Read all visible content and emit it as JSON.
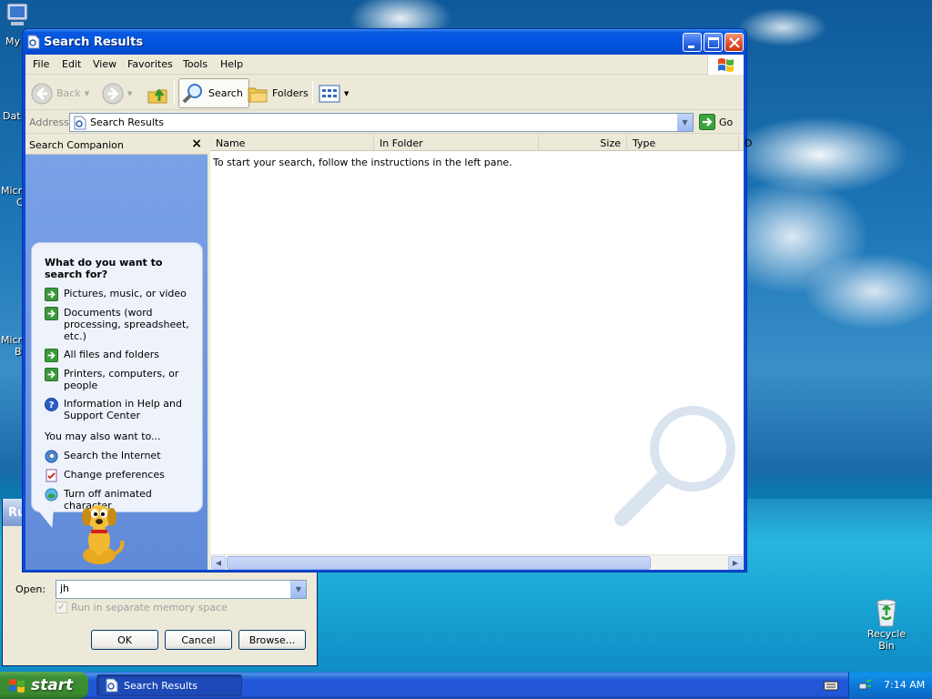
{
  "desktop": {
    "icons": [
      {
        "label": "My",
        "name": "my-computer"
      },
      {
        "label": "Dat",
        "name": "data"
      },
      {
        "label": "Micr",
        "name": "micr-1"
      },
      {
        "label": "C",
        "name": "c"
      },
      {
        "label": "Micr",
        "name": "micr-2"
      },
      {
        "label": "B",
        "name": "b"
      }
    ],
    "recycle_bin_label": "Recycle Bin"
  },
  "run_dialog": {
    "title_partial": "Ru",
    "open_label": "Open:",
    "open_value": "jh",
    "checkbox_label": "Run in separate memory space",
    "checkbox_checked": true,
    "ok_label": "OK",
    "cancel_label": "Cancel",
    "browse_label": "Browse..."
  },
  "window": {
    "title": "Search Results",
    "menu": [
      "File",
      "Edit",
      "View",
      "Favorites",
      "Tools",
      "Help"
    ],
    "toolbar": {
      "back_label": "Back",
      "search_label": "Search",
      "folders_label": "Folders"
    },
    "address": {
      "label": "Address",
      "value": "Search Results",
      "go_label": "Go"
    },
    "companion": {
      "header": "Search Companion",
      "question": "What do you want to search for?",
      "options": [
        "Pictures, music, or video",
        "Documents (word processing, spreadsheet, etc.)",
        "All files and folders",
        "Printers, computers, or people",
        "Information in Help and Support Center"
      ],
      "also_label": "You may also want to...",
      "also_options": [
        "Search the Internet",
        "Change preferences",
        "Turn off animated character"
      ]
    },
    "list": {
      "columns": [
        "Name",
        "In Folder",
        "Size",
        "Type",
        "D"
      ],
      "empty_message": "To start your search, follow the instructions in the left pane."
    }
  },
  "taskbar": {
    "start_label": "start",
    "task_label": "Search Results",
    "clock": "7:14 AM"
  },
  "colors": {
    "titlebar": "#0250d8",
    "taskbar": "#2157d7",
    "start_button": "#3c8e33",
    "companion_pane": "#7ba2e7"
  }
}
